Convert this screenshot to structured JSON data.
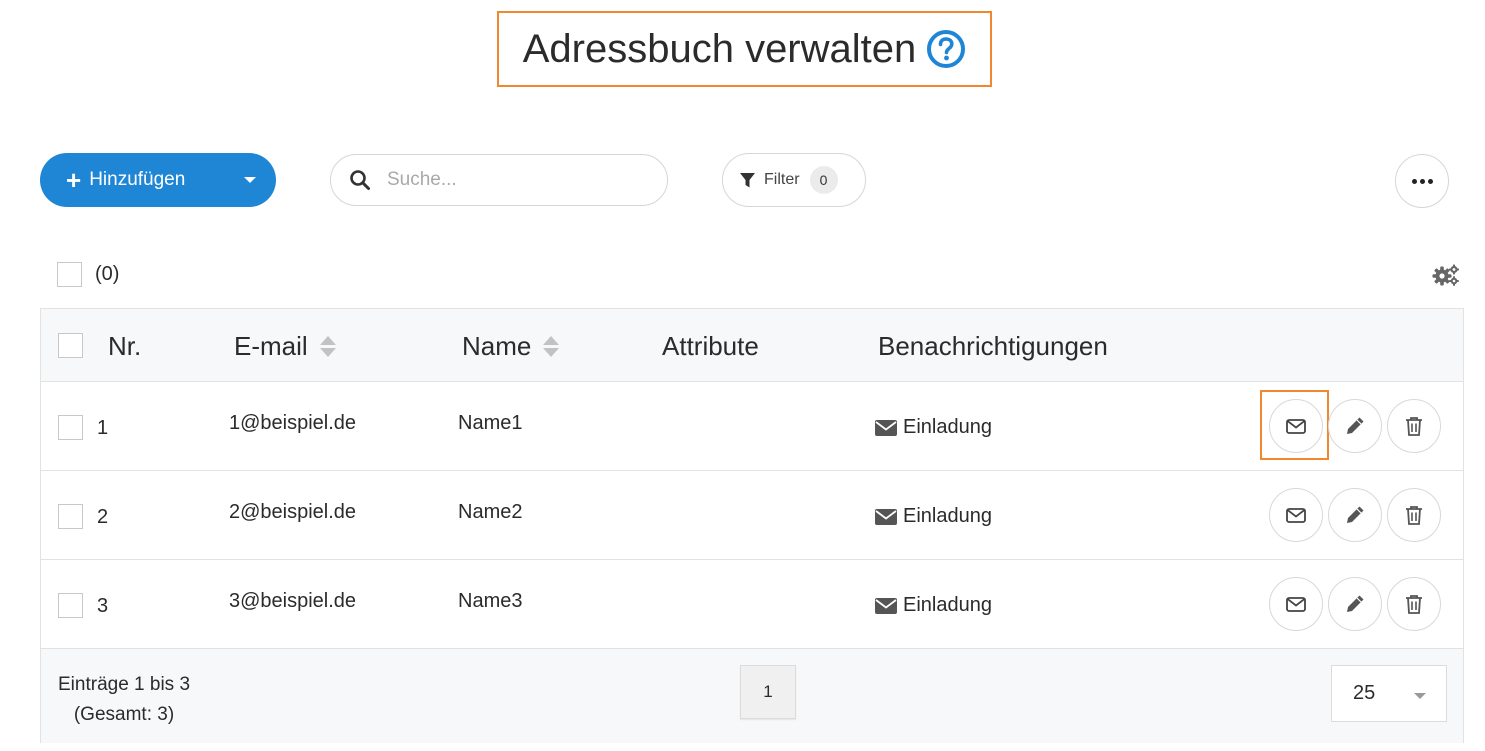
{
  "header": {
    "title": "Adressbuch verwalten",
    "help_icon": "question-circle-icon",
    "accent": "#1f86d6",
    "highlight": "#f0882f"
  },
  "toolbar": {
    "add_label": "Hinzufügen",
    "search_placeholder": "Suche...",
    "filter_label": "Filter",
    "filter_count": "0",
    "more_icon": "ellipsis-icon"
  },
  "selection": {
    "count_label": "(0)",
    "settings_icon": "gears-icon"
  },
  "table": {
    "columns": {
      "nr": "Nr.",
      "email": "E-mail",
      "name": "Name",
      "attribute": "Attribute",
      "notifications": "Benachrichtigungen"
    },
    "rows": [
      {
        "nr": "1",
        "email": "1@beispiel.de",
        "name": "Name1",
        "attribute": "",
        "notification": "Einladung"
      },
      {
        "nr": "2",
        "email": "2@beispiel.de",
        "name": "Name2",
        "attribute": "",
        "notification": "Einladung"
      },
      {
        "nr": "3",
        "email": "3@beispiel.de",
        "name": "Name3",
        "attribute": "",
        "notification": "Einladung"
      }
    ]
  },
  "footer": {
    "entries_line1": "Einträge 1 bis 3",
    "entries_line2": "(Gesamt: 3)",
    "current_page": "1",
    "page_size": "25"
  }
}
